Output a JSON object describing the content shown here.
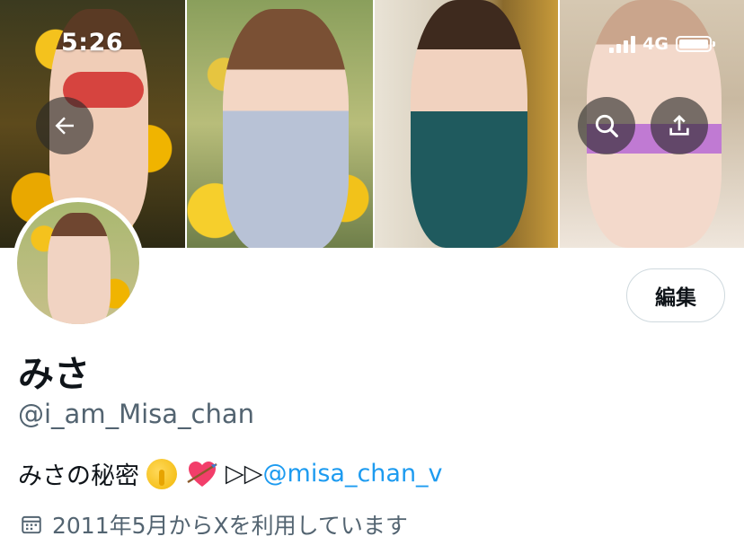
{
  "status_bar": {
    "time": "5:26",
    "network": "4G"
  },
  "profile": {
    "display_name": "みさ",
    "handle": "@i_am_Misa_chan",
    "edit_button_label": "編集",
    "bio": {
      "text": "みさの秘密",
      "arrows": "▷▷",
      "mention": "@misa_chan_v"
    },
    "joined": "2011年5月からXを利用しています"
  },
  "icons": [
    "back-arrow-icon",
    "search-icon",
    "share-icon",
    "calendar-icon",
    "shushing-face-emoji",
    "heart-with-arrow-emoji"
  ],
  "colors": {
    "link": "#1d9bf0",
    "secondary_text": "#536471",
    "primary_text": "#0f1419"
  }
}
